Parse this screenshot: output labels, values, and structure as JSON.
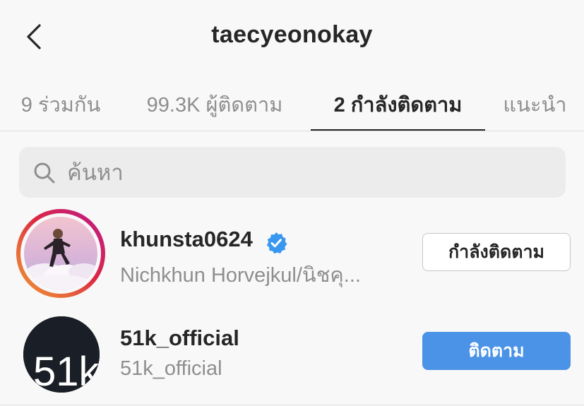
{
  "header": {
    "title": "taecyeonokay",
    "back_icon": "chevron-left-icon"
  },
  "tabs": [
    {
      "label": "9 ร่วมกัน",
      "active": false
    },
    {
      "label": "99.3K ผู้ติดตาม",
      "active": false
    },
    {
      "label": "2 กำลังติดตาม",
      "active": true
    },
    {
      "label": "แนะนำ",
      "active": false
    }
  ],
  "search": {
    "placeholder": "ค้นหา",
    "value": "",
    "icon": "search-icon"
  },
  "accounts": [
    {
      "username": "khunsta0624",
      "verified": true,
      "full_name": "Nichkhun Horvejkul/นิชคุ...",
      "button_label": "กำลังติดตาม",
      "has_story_ring": true
    },
    {
      "username": "51k_official",
      "verified": false,
      "full_name": "51k_official",
      "button_label": "ติดตาม",
      "avatar_text": "51k"
    }
  ],
  "colors": {
    "follow_button": "#4b93e6",
    "verified_badge": "#3897f0",
    "text_primary": "#262626",
    "text_secondary": "#8e8e8e"
  }
}
